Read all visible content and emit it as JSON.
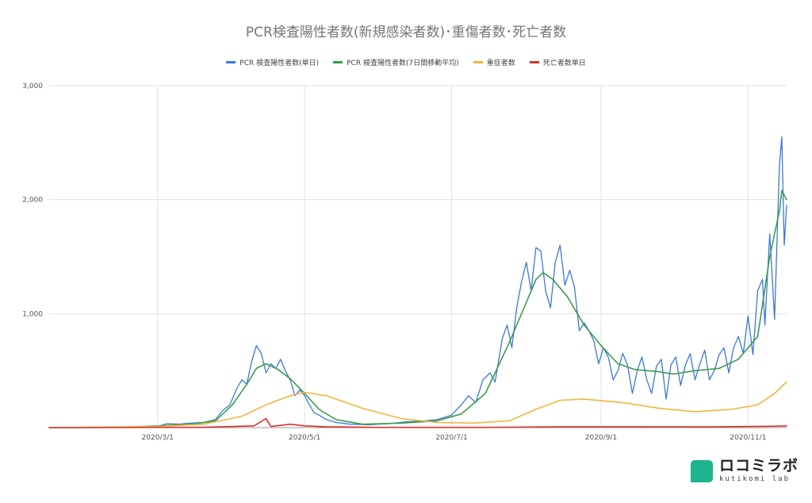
{
  "chart_data": {
    "type": "line",
    "title": "PCR検査陽性者数(新規感染者数)･重傷者数･死亡者数",
    "xlabel": "",
    "ylabel": "",
    "ylim": [
      0,
      3000
    ],
    "yticks": [
      "3,000",
      "2,000",
      "1,000"
    ],
    "x_range": [
      "2020-01-16",
      "2020-11-17"
    ],
    "x_ticks": [
      {
        "date": "2020-03-01",
        "label": "2020/3/1"
      },
      {
        "date": "2020-05-01",
        "label": "2020/5/1"
      },
      {
        "date": "2020-07-01",
        "label": "2020/7/1"
      },
      {
        "date": "2020-09-01",
        "label": "2020/9/1"
      },
      {
        "date": "2020-11-01",
        "label": "2020/11/1"
      }
    ],
    "grid": true,
    "legend_position": "top",
    "series": [
      {
        "name": "PCR 検査陽性者数(単日)",
        "color": "#3b78d8",
        "points": [
          [
            "2020-01-16",
            0
          ],
          [
            "2020-02-15",
            2
          ],
          [
            "2020-03-01",
            12
          ],
          [
            "2020-03-05",
            35
          ],
          [
            "2020-03-10",
            30
          ],
          [
            "2020-03-15",
            40
          ],
          [
            "2020-03-20",
            45
          ],
          [
            "2020-03-25",
            70
          ],
          [
            "2020-03-28",
            150
          ],
          [
            "2020-03-31",
            200
          ],
          [
            "2020-04-03",
            350
          ],
          [
            "2020-04-05",
            420
          ],
          [
            "2020-04-07",
            380
          ],
          [
            "2020-04-09",
            580
          ],
          [
            "2020-04-11",
            720
          ],
          [
            "2020-04-13",
            650
          ],
          [
            "2020-04-15",
            480
          ],
          [
            "2020-04-17",
            560
          ],
          [
            "2020-04-19",
            520
          ],
          [
            "2020-04-21",
            600
          ],
          [
            "2020-04-23",
            500
          ],
          [
            "2020-04-25",
            420
          ],
          [
            "2020-04-27",
            280
          ],
          [
            "2020-04-29",
            330
          ],
          [
            "2020-05-01",
            280
          ],
          [
            "2020-05-03",
            200
          ],
          [
            "2020-05-05",
            130
          ],
          [
            "2020-05-07",
            110
          ],
          [
            "2020-05-10",
            70
          ],
          [
            "2020-05-14",
            45
          ],
          [
            "2020-05-20",
            30
          ],
          [
            "2020-05-28",
            25
          ],
          [
            "2020-06-05",
            35
          ],
          [
            "2020-06-12",
            50
          ],
          [
            "2020-06-20",
            60
          ],
          [
            "2020-06-25",
            70
          ],
          [
            "2020-07-01",
            110
          ],
          [
            "2020-07-05",
            200
          ],
          [
            "2020-07-08",
            280
          ],
          [
            "2020-07-11",
            220
          ],
          [
            "2020-07-14",
            420
          ],
          [
            "2020-07-17",
            480
          ],
          [
            "2020-07-19",
            400
          ],
          [
            "2020-07-22",
            780
          ],
          [
            "2020-07-24",
            900
          ],
          [
            "2020-07-26",
            700
          ],
          [
            "2020-07-28",
            1050
          ],
          [
            "2020-07-30",
            1280
          ],
          [
            "2020-08-01",
            1450
          ],
          [
            "2020-08-03",
            1200
          ],
          [
            "2020-08-05",
            1580
          ],
          [
            "2020-08-07",
            1550
          ],
          [
            "2020-08-09",
            1200
          ],
          [
            "2020-08-11",
            1050
          ],
          [
            "2020-08-13",
            1450
          ],
          [
            "2020-08-15",
            1600
          ],
          [
            "2020-08-17",
            1250
          ],
          [
            "2020-08-19",
            1380
          ],
          [
            "2020-08-21",
            1230
          ],
          [
            "2020-08-23",
            850
          ],
          [
            "2020-08-25",
            920
          ],
          [
            "2020-08-27",
            850
          ],
          [
            "2020-08-29",
            760
          ],
          [
            "2020-08-31",
            560
          ],
          [
            "2020-09-02",
            700
          ],
          [
            "2020-09-04",
            620
          ],
          [
            "2020-09-06",
            420
          ],
          [
            "2020-09-08",
            500
          ],
          [
            "2020-09-10",
            650
          ],
          [
            "2020-09-12",
            550
          ],
          [
            "2020-09-14",
            300
          ],
          [
            "2020-09-16",
            500
          ],
          [
            "2020-09-18",
            620
          ],
          [
            "2020-09-20",
            420
          ],
          [
            "2020-09-22",
            300
          ],
          [
            "2020-09-24",
            540
          ],
          [
            "2020-09-26",
            600
          ],
          [
            "2020-09-28",
            250
          ],
          [
            "2020-09-30",
            550
          ],
          [
            "2020-10-02",
            620
          ],
          [
            "2020-10-04",
            370
          ],
          [
            "2020-10-06",
            550
          ],
          [
            "2020-10-08",
            650
          ],
          [
            "2020-10-10",
            420
          ],
          [
            "2020-10-12",
            560
          ],
          [
            "2020-10-14",
            680
          ],
          [
            "2020-10-16",
            420
          ],
          [
            "2020-10-18",
            500
          ],
          [
            "2020-10-20",
            640
          ],
          [
            "2020-10-22",
            700
          ],
          [
            "2020-10-24",
            480
          ],
          [
            "2020-10-26",
            700
          ],
          [
            "2020-10-28",
            800
          ],
          [
            "2020-10-30",
            650
          ],
          [
            "2020-11-01",
            980
          ],
          [
            "2020-11-03",
            640
          ],
          [
            "2020-11-05",
            1200
          ],
          [
            "2020-11-07",
            1300
          ],
          [
            "2020-11-08",
            900
          ],
          [
            "2020-11-10",
            1700
          ],
          [
            "2020-11-12",
            950
          ],
          [
            "2020-11-14",
            2300
          ],
          [
            "2020-11-15",
            2550
          ],
          [
            "2020-11-16",
            1600
          ],
          [
            "2020-11-17",
            1950
          ]
        ]
      },
      {
        "name": "PCR 検査陽性者数(7日間移動平均)",
        "color": "#3b9c48",
        "points": [
          [
            "2020-01-16",
            0
          ],
          [
            "2020-02-15",
            2
          ],
          [
            "2020-03-01",
            15
          ],
          [
            "2020-03-15",
            30
          ],
          [
            "2020-03-25",
            60
          ],
          [
            "2020-04-01",
            200
          ],
          [
            "2020-04-07",
            380
          ],
          [
            "2020-04-11",
            520
          ],
          [
            "2020-04-15",
            560
          ],
          [
            "2020-04-20",
            510
          ],
          [
            "2020-04-25",
            430
          ],
          [
            "2020-05-01",
            300
          ],
          [
            "2020-05-07",
            160
          ],
          [
            "2020-05-14",
            70
          ],
          [
            "2020-05-25",
            30
          ],
          [
            "2020-06-10",
            40
          ],
          [
            "2020-06-25",
            60
          ],
          [
            "2020-07-05",
            120
          ],
          [
            "2020-07-15",
            300
          ],
          [
            "2020-07-25",
            750
          ],
          [
            "2020-08-01",
            1100
          ],
          [
            "2020-08-05",
            1300
          ],
          [
            "2020-08-08",
            1360
          ],
          [
            "2020-08-12",
            1300
          ],
          [
            "2020-08-18",
            1150
          ],
          [
            "2020-08-25",
            900
          ],
          [
            "2020-09-01",
            720
          ],
          [
            "2020-09-08",
            560
          ],
          [
            "2020-09-15",
            510
          ],
          [
            "2020-09-25",
            490
          ],
          [
            "2020-10-01",
            470
          ],
          [
            "2020-10-10",
            500
          ],
          [
            "2020-10-20",
            520
          ],
          [
            "2020-10-28",
            600
          ],
          [
            "2020-11-05",
            800
          ],
          [
            "2020-11-10",
            1500
          ],
          [
            "2020-11-14",
            1900
          ],
          [
            "2020-11-15",
            2080
          ],
          [
            "2020-11-17",
            2000
          ]
        ]
      },
      {
        "name": "重症者数",
        "color": "#f2b53c",
        "points": [
          [
            "2020-01-16",
            0
          ],
          [
            "2020-03-01",
            10
          ],
          [
            "2020-03-20",
            30
          ],
          [
            "2020-04-05",
            100
          ],
          [
            "2020-04-15",
            200
          ],
          [
            "2020-04-25",
            280
          ],
          [
            "2020-05-01",
            310
          ],
          [
            "2020-05-10",
            280
          ],
          [
            "2020-05-25",
            170
          ],
          [
            "2020-06-10",
            80
          ],
          [
            "2020-06-25",
            45
          ],
          [
            "2020-07-10",
            40
          ],
          [
            "2020-07-25",
            60
          ],
          [
            "2020-08-05",
            160
          ],
          [
            "2020-08-15",
            240
          ],
          [
            "2020-08-25",
            250
          ],
          [
            "2020-09-10",
            220
          ],
          [
            "2020-09-25",
            170
          ],
          [
            "2020-10-10",
            140
          ],
          [
            "2020-10-25",
            160
          ],
          [
            "2020-11-05",
            200
          ],
          [
            "2020-11-12",
            300
          ],
          [
            "2020-11-17",
            400
          ]
        ]
      },
      {
        "name": "死亡者数単日",
        "color": "#d93030",
        "points": [
          [
            "2020-01-16",
            0
          ],
          [
            "2020-03-20",
            3
          ],
          [
            "2020-04-10",
            15
          ],
          [
            "2020-04-15",
            80
          ],
          [
            "2020-04-17",
            10
          ],
          [
            "2020-04-25",
            30
          ],
          [
            "2020-05-01",
            15
          ],
          [
            "2020-05-10",
            8
          ],
          [
            "2020-06-01",
            2
          ],
          [
            "2020-07-15",
            2
          ],
          [
            "2020-08-15",
            8
          ],
          [
            "2020-09-15",
            8
          ],
          [
            "2020-10-15",
            6
          ],
          [
            "2020-11-10",
            12
          ],
          [
            "2020-11-17",
            15
          ]
        ]
      }
    ]
  },
  "logo": {
    "jp": "ロコミラボ",
    "en": "kutikomi lab"
  }
}
